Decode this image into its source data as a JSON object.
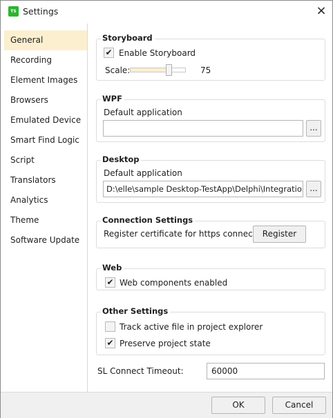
{
  "window": {
    "title": "Settings",
    "logo_text": "TS",
    "close_icon": "×"
  },
  "sidebar": {
    "items": [
      {
        "label": "General",
        "active": true
      },
      {
        "label": "Recording"
      },
      {
        "label": "Element Images"
      },
      {
        "label": "Browsers"
      },
      {
        "label": "Emulated Device"
      },
      {
        "label": "Smart Find Logic"
      },
      {
        "label": "Script"
      },
      {
        "label": "Translators"
      },
      {
        "label": "Analytics"
      },
      {
        "label": "Theme"
      },
      {
        "label": "Software Update"
      }
    ]
  },
  "storyboard": {
    "title": "Storyboard",
    "enable_label": "Enable Storyboard",
    "enabled": true,
    "scale_label": "Scale:",
    "scale_value": "75",
    "slider_fraction": 0.69
  },
  "wpf": {
    "title": "WPF",
    "default_app_label": "Default application",
    "default_app_value": "",
    "browse_label": "..."
  },
  "desktop": {
    "title": "Desktop",
    "default_app_label": "Default application",
    "default_app_value": "D:\\elle\\sample Desktop-TestApp\\Delphi\\IntegrationT",
    "browse_label": "..."
  },
  "connection": {
    "title": "Connection Settings",
    "register_text": "Register certificate for https connection",
    "register_button": "Register"
  },
  "web": {
    "title": "Web",
    "components_label": "Web components enabled",
    "components_enabled": true
  },
  "other": {
    "title": "Other Settings",
    "track_label": "Track active file in project explorer",
    "track_checked": false,
    "preserve_label": "Preserve project state",
    "preserve_checked": true
  },
  "timeout": {
    "label": "SL Connect Timeout:",
    "value": "60000"
  },
  "footer": {
    "ok": "OK",
    "cancel": "Cancel"
  },
  "check_glyph": "✔"
}
